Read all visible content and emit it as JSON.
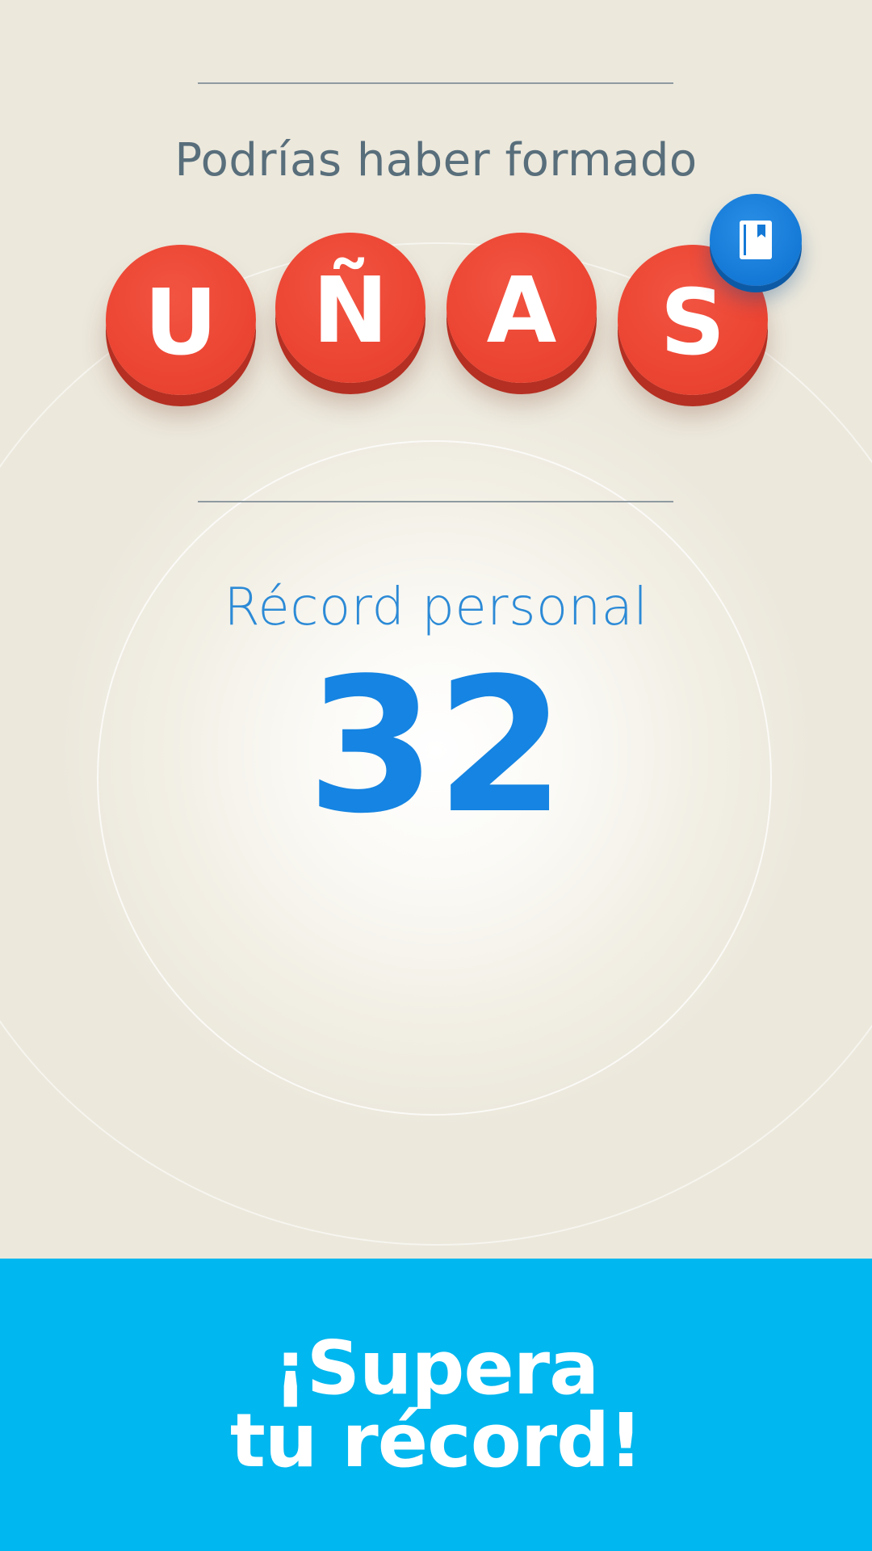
{
  "header": {
    "headline": "Podrías haber formado"
  },
  "word": {
    "letters": [
      "U",
      "Ñ",
      "A",
      "S"
    ],
    "tile_color": "#ec4533",
    "badge_icon": "book-icon",
    "badge_color": "#1479d6"
  },
  "record": {
    "label": "Récord personal",
    "value": "32",
    "color": "#1584e2"
  },
  "cta": {
    "line1": "¡Supera",
    "line2": "tu récord!",
    "background": "#00b7ef"
  }
}
